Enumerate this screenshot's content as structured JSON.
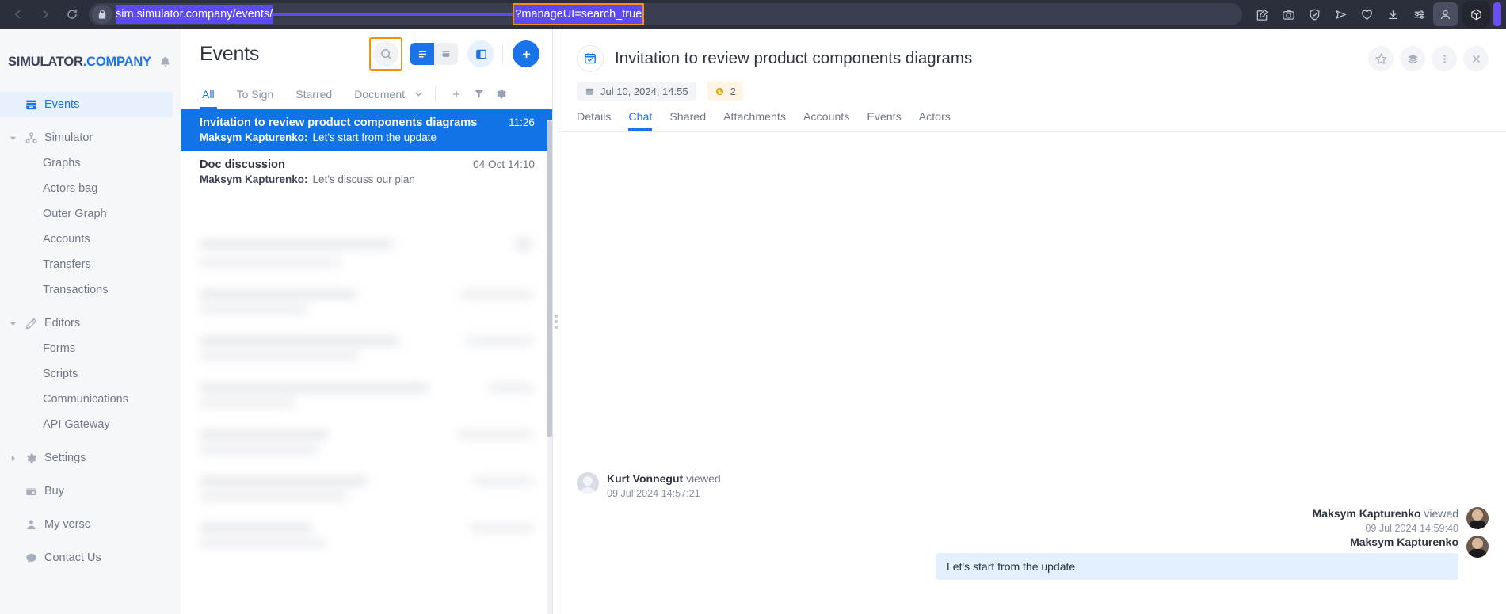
{
  "browser": {
    "nav": {
      "back": "back-arrow",
      "forward": "forward-arrow",
      "reload": "reload"
    },
    "url": {
      "lock_icon": "lock-icon",
      "prefix": "sim.simulator.company/events/",
      "suffix": "?manageUI=search_true",
      "selected": true,
      "highlight_color": "#f2930d",
      "selection_color": "#5b4bf0"
    },
    "actions": [
      {
        "name": "edit-note-icon",
        "glyph": "edit"
      },
      {
        "name": "screenshot-camera-icon",
        "glyph": "camera"
      },
      {
        "name": "shield-check-icon",
        "glyph": "shield"
      },
      {
        "name": "send-icon",
        "glyph": "send"
      },
      {
        "name": "heart-icon",
        "glyph": "heart"
      },
      {
        "name": "download-icon",
        "glyph": "download"
      },
      {
        "name": "sliders-icon",
        "glyph": "sliders"
      },
      {
        "name": "profile-icon",
        "glyph": "profile"
      }
    ],
    "extension_icon": "cube-icon"
  },
  "sidebar": {
    "brand_primary": "SIMULATOR",
    "brand_secondary": ".COMPANY",
    "bell_icon": "bell-icon",
    "items": [
      {
        "label": "Events",
        "icon": "inbox-icon",
        "level": 0,
        "active": true,
        "caret": "none"
      },
      {
        "label": "Simulator",
        "icon": "network-icon",
        "level": 0,
        "active": false,
        "caret": "down"
      },
      {
        "label": "Graphs",
        "icon": "",
        "level": 1,
        "active": false,
        "caret": "none"
      },
      {
        "label": "Actors bag",
        "icon": "",
        "level": 1,
        "active": false,
        "caret": "none"
      },
      {
        "label": "Outer Graph",
        "icon": "",
        "level": 1,
        "active": false,
        "caret": "none"
      },
      {
        "label": "Accounts",
        "icon": "",
        "level": 1,
        "active": false,
        "caret": "none"
      },
      {
        "label": "Transfers",
        "icon": "",
        "level": 1,
        "active": false,
        "caret": "none"
      },
      {
        "label": "Transactions",
        "icon": "",
        "level": 1,
        "active": false,
        "caret": "none"
      },
      {
        "label": "Editors",
        "icon": "pencil-icon",
        "level": 0,
        "active": false,
        "caret": "down"
      },
      {
        "label": "Forms",
        "icon": "",
        "level": 1,
        "active": false,
        "caret": "none"
      },
      {
        "label": "Scripts",
        "icon": "",
        "level": 1,
        "active": false,
        "caret": "none"
      },
      {
        "label": "Communications",
        "icon": "",
        "level": 1,
        "active": false,
        "caret": "none"
      },
      {
        "label": "API Gateway",
        "icon": "",
        "level": 1,
        "active": false,
        "caret": "none"
      },
      {
        "label": "Settings",
        "icon": "gear-icon",
        "level": 0,
        "active": false,
        "caret": "right"
      },
      {
        "label": "Buy",
        "icon": "wallet-icon",
        "level": 0,
        "active": false,
        "caret": "none"
      },
      {
        "label": "My verse",
        "icon": "user-icon",
        "level": 0,
        "active": false,
        "caret": "none"
      },
      {
        "label": "Contact Us",
        "icon": "chat-icon",
        "level": 0,
        "active": false,
        "caret": "none"
      }
    ]
  },
  "list_panel": {
    "title": "Events",
    "search_icon": "search-icon",
    "search_highlighted": true,
    "view_list_icon": "list-view-icon",
    "view_card_icon": "card-view-icon",
    "panel_toggle_icon": "split-panel-icon",
    "add_icon": "plus-icon",
    "filters": [
      {
        "label": "All",
        "active": true
      },
      {
        "label": "To Sign",
        "active": false
      },
      {
        "label": "Starred",
        "active": false
      },
      {
        "label": "Document",
        "active": false,
        "has_caret": true
      }
    ],
    "filter_actions": [
      {
        "name": "add-filter-icon",
        "glyph": "plus"
      },
      {
        "name": "filter-funnel-icon",
        "glyph": "funnel"
      },
      {
        "name": "settings-gear-icon",
        "glyph": "gear"
      }
    ],
    "rows": [
      {
        "title": "Invitation to review product components diagrams",
        "time": "11:26",
        "author": "Maksym Kapturenko:",
        "preview": "Let's start from the update",
        "selected": true
      },
      {
        "title": "Doc discussion",
        "time": "04 Oct 14:10",
        "author": "Maksym Kapturenko:",
        "preview": "Let's discuss our plan",
        "selected": false
      }
    ]
  },
  "detail": {
    "icon": "calendar-check-icon",
    "title": "Invitation to review product components diagrams",
    "date_chip": {
      "icon": "calendar-icon",
      "text": "Jul 10, 2024; 14:55"
    },
    "coin_chip": {
      "icon": "coin-icon",
      "text": "2"
    },
    "actions": [
      {
        "name": "star-icon",
        "glyph": "star"
      },
      {
        "name": "layers-icon",
        "glyph": "layers"
      },
      {
        "name": "more-vertical-icon",
        "glyph": "dots"
      },
      {
        "name": "close-icon",
        "glyph": "x"
      }
    ],
    "tabs": [
      {
        "label": "Details",
        "active": false
      },
      {
        "label": "Chat",
        "active": true
      },
      {
        "label": "Shared",
        "active": false
      },
      {
        "label": "Attachments",
        "active": false
      },
      {
        "label": "Accounts",
        "active": false
      },
      {
        "label": "Events",
        "active": false
      },
      {
        "label": "Actors",
        "active": false
      }
    ],
    "messages": [
      {
        "side": "left",
        "avatar": "generic",
        "name": "Kurt Vonnegut",
        "action": "viewed",
        "time": "09 Jul 2024 14:57:21",
        "text": ""
      },
      {
        "side": "right",
        "avatar": "photo",
        "name": "Maksym Kapturenko",
        "action": "viewed",
        "time": "09 Jul 2024 14:59:40",
        "text": ""
      },
      {
        "side": "right",
        "avatar": "photo",
        "name": "Maksym Kapturenko",
        "action": "",
        "time": "",
        "text": "Let's start from the update"
      }
    ]
  },
  "colors": {
    "accent": "#1a73e8",
    "selection_purple": "#5b4bf0",
    "highlight_orange": "#f2930d",
    "chrome_dark": "#2b2e3b",
    "bubble_blue": "#e3f0fd"
  }
}
